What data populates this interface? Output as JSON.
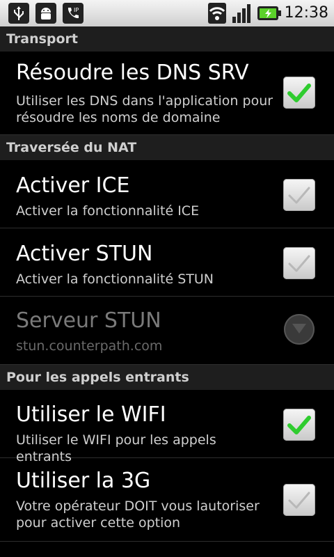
{
  "status_bar": {
    "left_icons": [
      "usb-icon",
      "android-debug-icon",
      "sip-call-icon"
    ],
    "right_icons": [
      "wifi-icon",
      "signal-icon",
      "battery-charging-icon"
    ],
    "time": "12:38"
  },
  "sections": [
    {
      "header": "Transport",
      "items": [
        {
          "title": "Résoudre les DNS SRV",
          "summary": "Utiliser les DNS dans l'application pour résoudre les noms de domaine",
          "control": "checkbox",
          "checked": true,
          "enabled": true
        }
      ]
    },
    {
      "header": "Traversée du NAT",
      "items": [
        {
          "title": "Activer ICE",
          "summary": "Activer la fonctionnalité ICE",
          "control": "checkbox",
          "checked": false,
          "enabled": true
        },
        {
          "title": "Activer STUN",
          "summary": "Activer la fonctionnalité STUN",
          "control": "checkbox",
          "checked": false,
          "enabled": true
        },
        {
          "title": "Serveur STUN",
          "summary": "stun.counterpath.com",
          "control": "dropdown",
          "enabled": false
        }
      ]
    },
    {
      "header": "Pour les appels entrants",
      "items": [
        {
          "title": "Utiliser le WIFI",
          "summary": "Utiliser le WIFI pour les appels entrants",
          "control": "checkbox",
          "checked": true,
          "enabled": true
        },
        {
          "title": "Utiliser la 3G",
          "summary": "Votre opérateur DOIT vous lautoriser pour activer cette option",
          "control": "checkbox",
          "checked": false,
          "enabled": true
        }
      ]
    }
  ],
  "colors": {
    "check_on": "#2fcc2f",
    "check_off": "#c4c4c4",
    "section_bg": "#1e1e1e"
  }
}
